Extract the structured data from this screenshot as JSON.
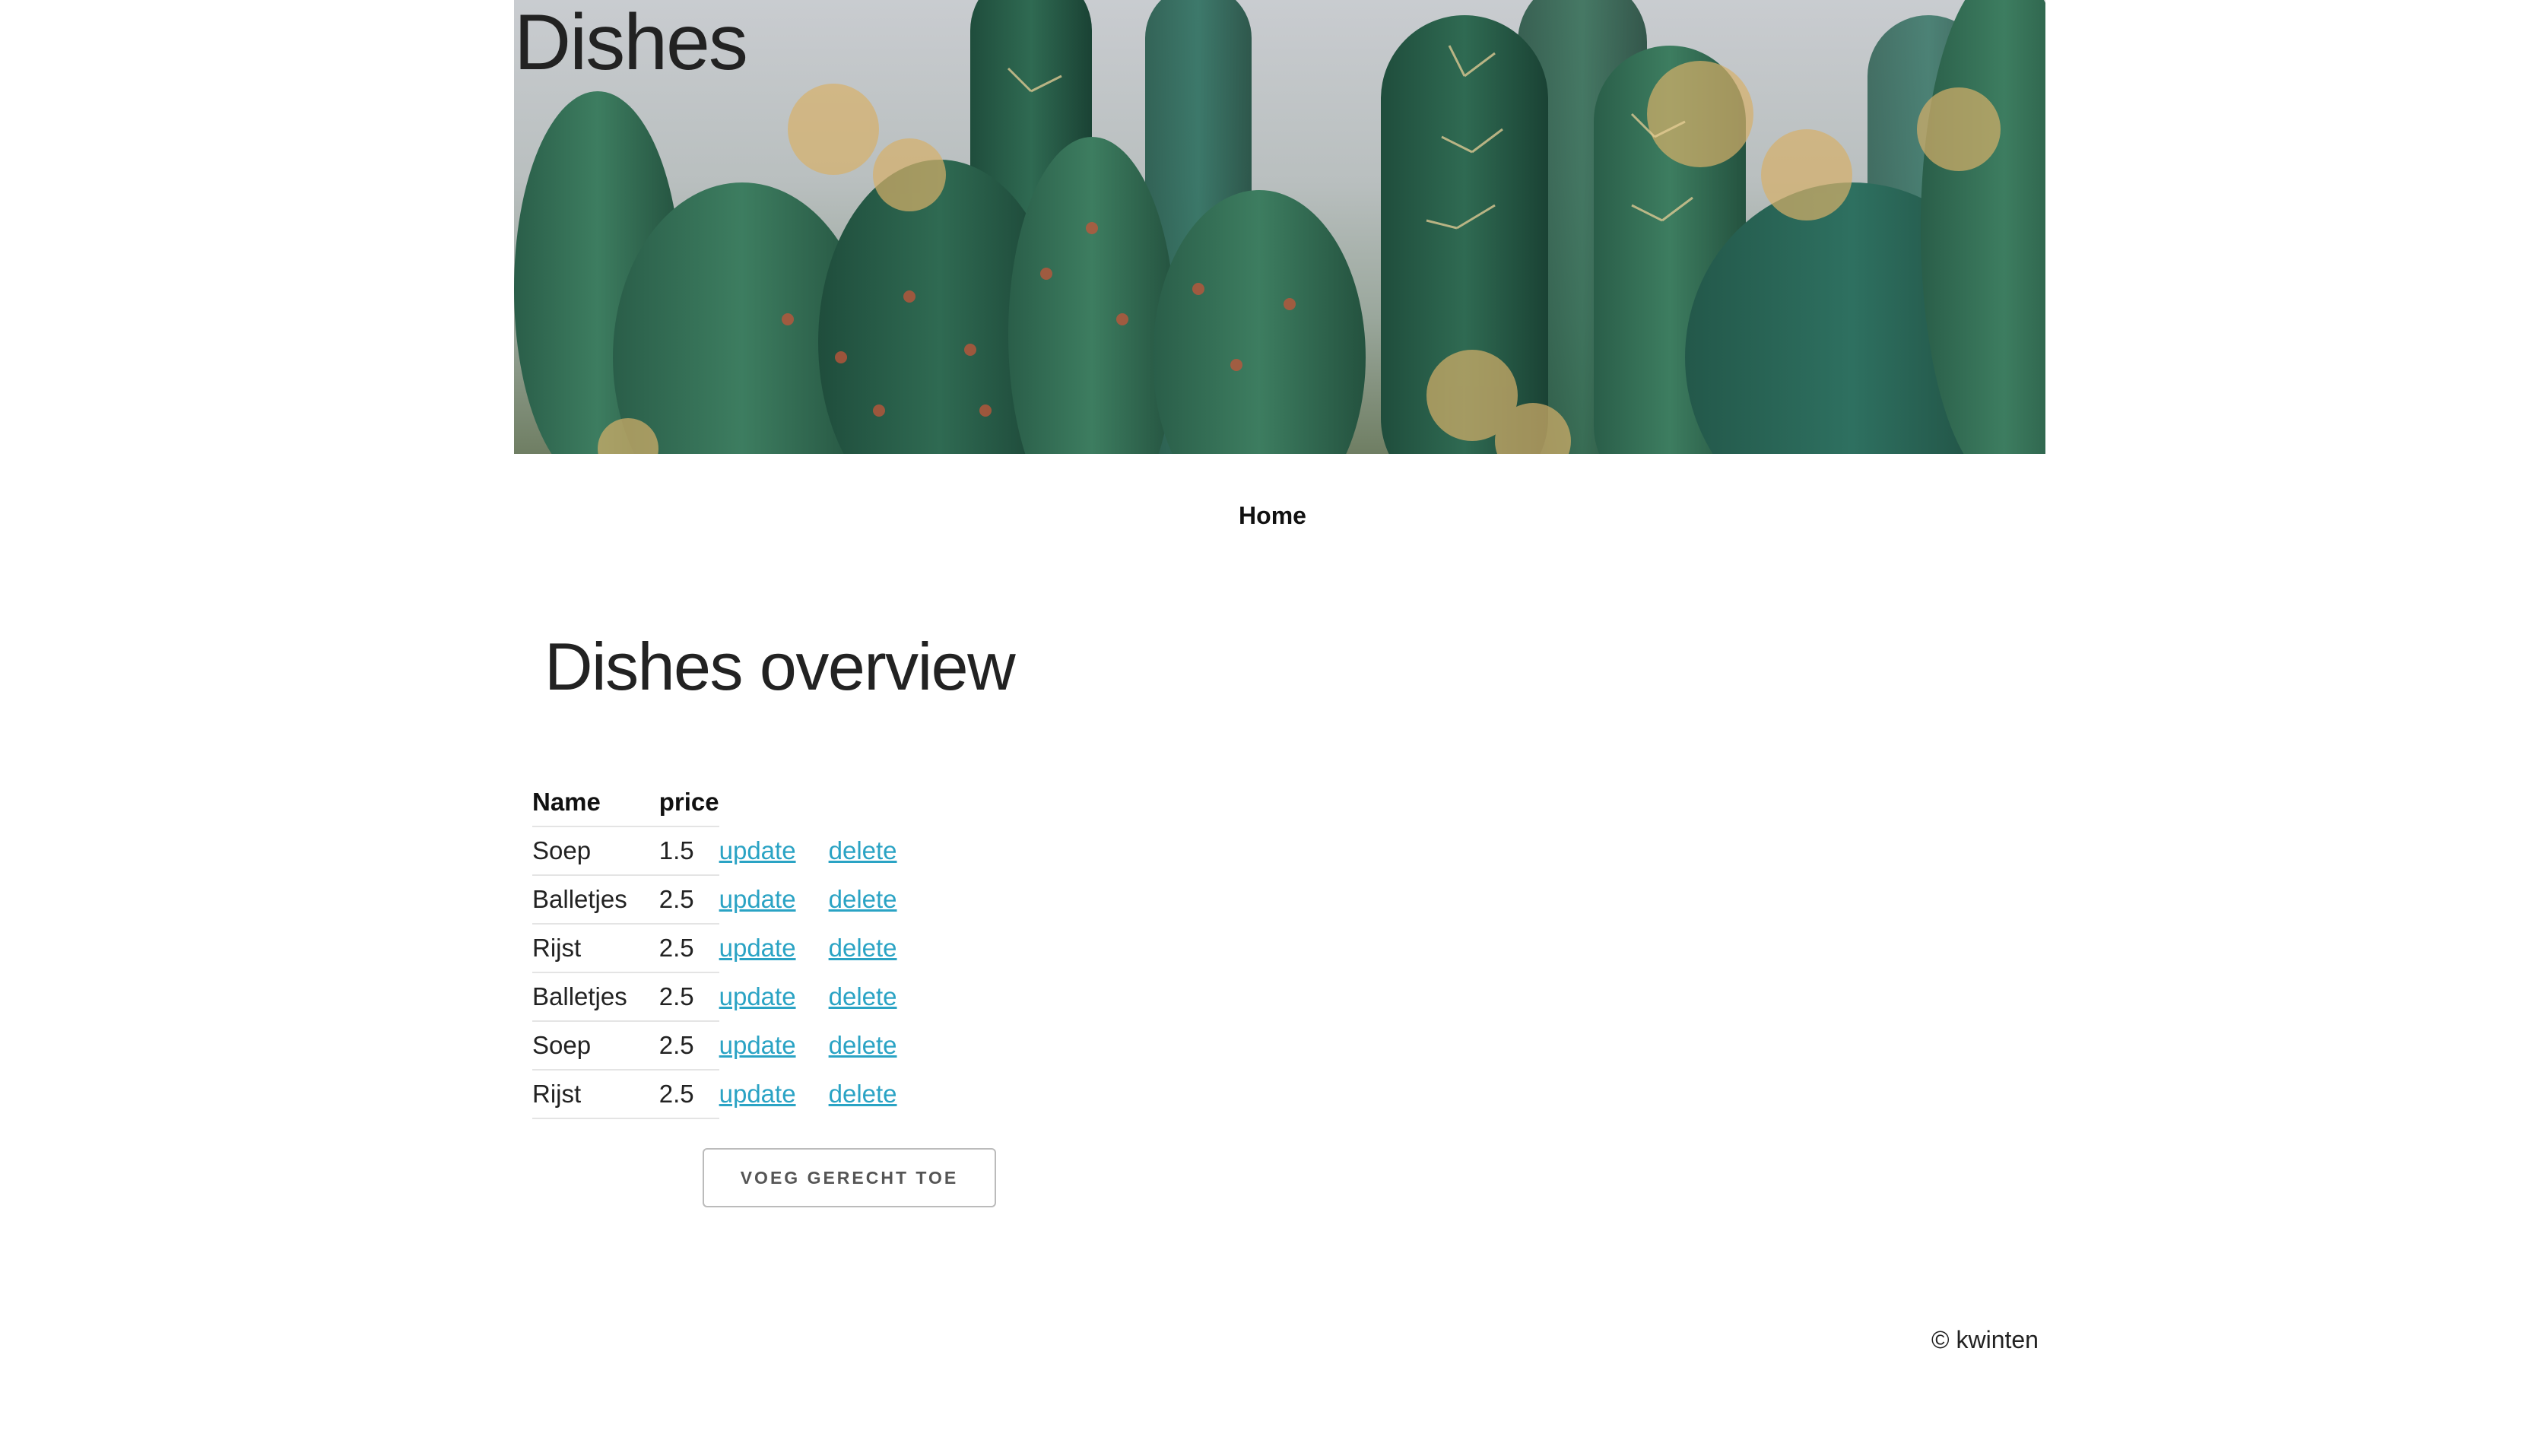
{
  "header": {
    "title": "Dishes",
    "banner_image": "cactus-banner"
  },
  "nav": {
    "items": [
      {
        "label": "Home"
      }
    ]
  },
  "main": {
    "title": "Dishes overview",
    "table": {
      "columns": [
        "Name",
        "price"
      ],
      "rows": [
        {
          "name": "Soep",
          "price": "1.5",
          "update": "update",
          "delete": "delete"
        },
        {
          "name": "Balletjes",
          "price": "2.5",
          "update": "update",
          "delete": "delete"
        },
        {
          "name": "Rijst",
          "price": "2.5",
          "update": "update",
          "delete": "delete"
        },
        {
          "name": "Balletjes",
          "price": "2.5",
          "update": "update",
          "delete": "delete"
        },
        {
          "name": "Soep",
          "price": "2.5",
          "update": "update",
          "delete": "delete"
        },
        {
          "name": "Rijst",
          "price": "2.5",
          "update": "update",
          "delete": "delete"
        }
      ]
    },
    "add_button_label": "VOEG GERECHT TOE"
  },
  "footer": {
    "text": "© kwinten"
  },
  "colors": {
    "link": "#2aa3c4",
    "text": "#222222",
    "button_border": "#bbbbbb"
  }
}
